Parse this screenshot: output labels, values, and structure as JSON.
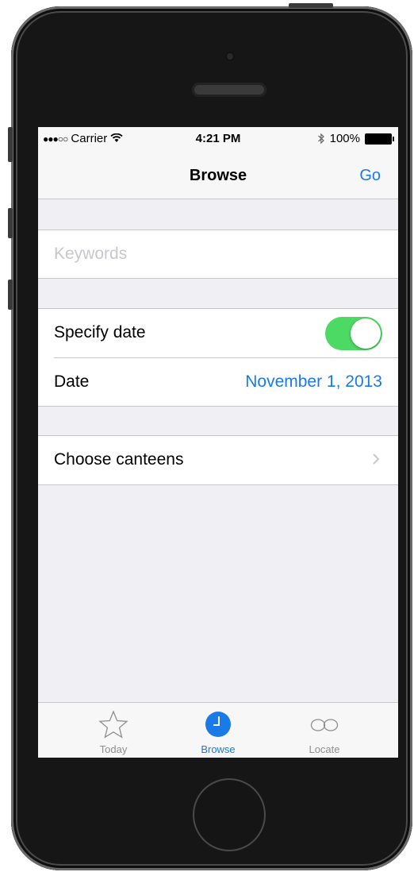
{
  "status_bar": {
    "signal": "●●●○○",
    "carrier": "Carrier",
    "time": "4:21 PM",
    "battery": "100%"
  },
  "nav": {
    "title": "Browse",
    "go_label": "Go"
  },
  "form": {
    "keywords_placeholder": "Keywords",
    "specify_date_label": "Specify date",
    "specify_date_on": true,
    "date_label": "Date",
    "date_value": "November 1, 2013",
    "choose_canteens_label": "Choose canteens"
  },
  "tabs": [
    {
      "label": "Today",
      "icon": "star-icon",
      "active": false
    },
    {
      "label": "Browse",
      "icon": "clock-icon",
      "active": true
    },
    {
      "label": "Locate",
      "icon": "glasses-icon",
      "active": false
    }
  ],
  "colors": {
    "accent": "#1a7ae8",
    "toggle_on": "#4cd964",
    "background": "#efeff4"
  }
}
